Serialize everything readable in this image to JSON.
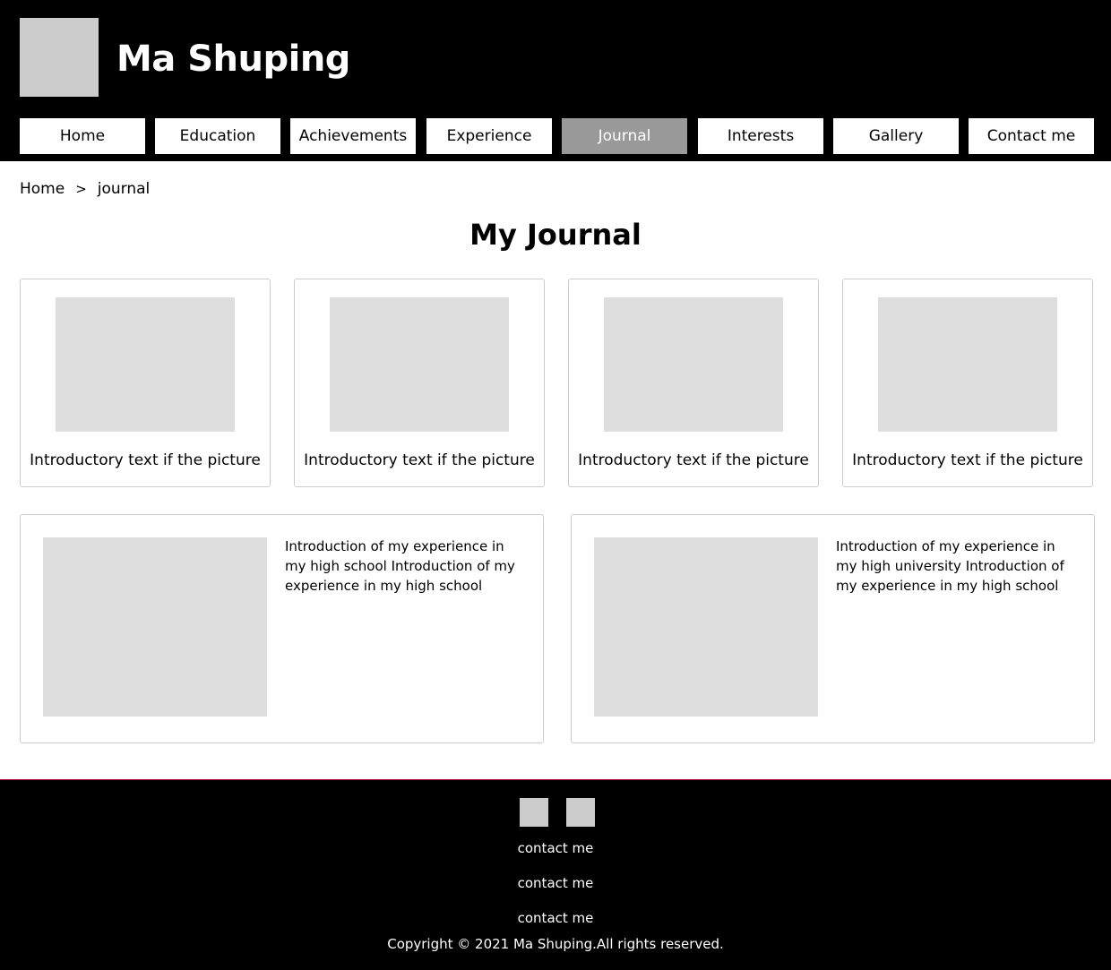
{
  "header": {
    "site_title": "Ma Shuping",
    "nav": [
      {
        "label": "Home",
        "active": false
      },
      {
        "label": "Education",
        "active": false
      },
      {
        "label": "Achievements",
        "active": false
      },
      {
        "label": "Experience",
        "active": false
      },
      {
        "label": "Journal",
        "active": true
      },
      {
        "label": "Interests",
        "active": false
      },
      {
        "label": "Gallery",
        "active": false
      },
      {
        "label": "Contact me",
        "active": false
      }
    ]
  },
  "breadcrumb": {
    "home": "Home",
    "separator": ">",
    "current": "journal"
  },
  "main": {
    "title": "My Journal",
    "picture_cards": [
      {
        "caption": "Introductory text if the picture"
      },
      {
        "caption": "Introductory text if the picture"
      },
      {
        "caption": "Introductory text if the picture"
      },
      {
        "caption": "Introductory text if the picture"
      }
    ],
    "experience_cards": [
      {
        "text": "Introduction of my experience in my high school Introduction of my experience in my high school"
      },
      {
        "text": "Introduction of my experience in my high university Introduction of my experience in my high school"
      }
    ]
  },
  "footer": {
    "links": [
      "contact me",
      "contact me",
      "contact me"
    ],
    "copyright": "Copyright © 2021 Ma Shuping.All rights reserved."
  },
  "colors": {
    "header_bg": "#000000",
    "active_nav": "#999999",
    "placeholder": "#dedede",
    "footer_border": "#b3003b"
  }
}
